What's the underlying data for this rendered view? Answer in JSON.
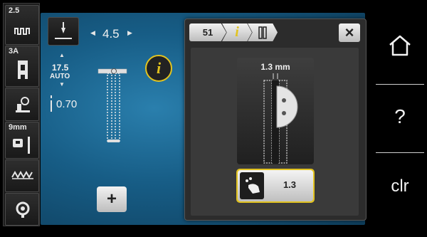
{
  "sidebar": {
    "width_label": "2.5",
    "foot_label": "3A",
    "needle_label": "9mm"
  },
  "stitch": {
    "width_value": "4.5",
    "length_value": "17.5",
    "auto_label": "AUTO",
    "balance_value": "0.70"
  },
  "info_button": {
    "label": "i"
  },
  "plus_button": {
    "label": "+"
  },
  "panel": {
    "tab_number": "51",
    "tab_info": "i",
    "slit_label": "1.3 mm",
    "slit_button_value": "1.3",
    "close_label": "×"
  },
  "nav": {
    "home_label": "home",
    "help_label": "?",
    "clr_label": "clr"
  },
  "colors": {
    "accent_yellow": "#e2c31f",
    "main_blue": "#175d86"
  }
}
